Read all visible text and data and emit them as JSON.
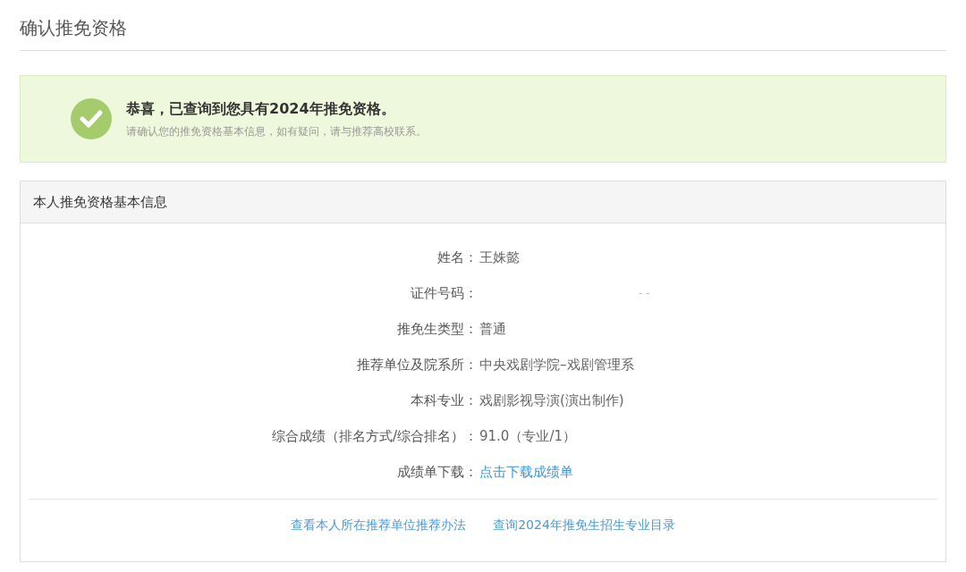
{
  "page_title": "确认推免资格",
  "alert": {
    "heading": "恭喜，已查询到您具有2024年推免资格。",
    "message": "请确认您的推免资格基本信息，如有疑问，请与推荐高校联系。"
  },
  "panel": {
    "title": "本人推免资格基本信息",
    "rows": [
      {
        "label": "姓名：",
        "value": "王姝懿",
        "kind": "text"
      },
      {
        "label": "证件号码：",
        "value": "- -",
        "kind": "masked"
      },
      {
        "label": "推免生类型：",
        "value": "普通",
        "kind": "text"
      },
      {
        "label": "推荐单位及院系所：",
        "value": "中央戏剧学院–戏剧管理系",
        "kind": "text"
      },
      {
        "label": "本科专业：",
        "value": "戏剧影视导演(演出制作)",
        "kind": "text"
      },
      {
        "label": "综合成绩（排名方式/综合排名）：",
        "value": "91.0（专业/1）",
        "kind": "text"
      },
      {
        "label": "成绩单下载：",
        "value": "点击下载成绩单",
        "kind": "link"
      }
    ],
    "footer_links": [
      "查看本人所在推荐单位推荐办法",
      "查询2024年推免生招生专业目录"
    ]
  }
}
